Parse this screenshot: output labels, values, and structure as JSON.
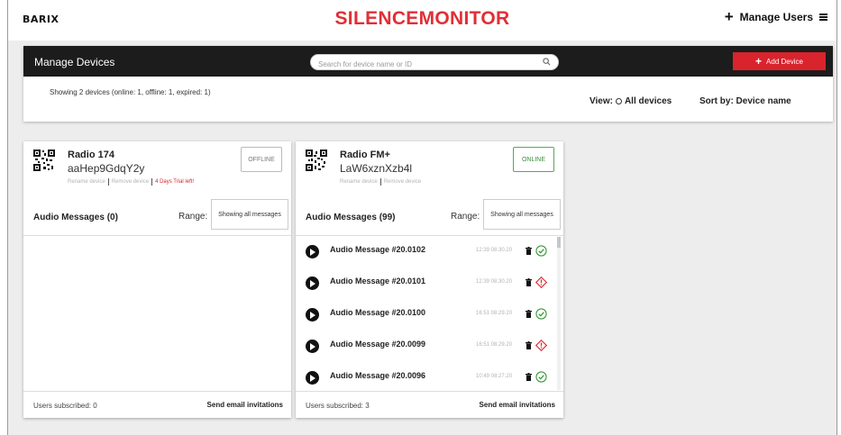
{
  "header": {
    "logo": "BARIX",
    "brand": "SILENCEMONITOR",
    "manage_users": "Manage Users"
  },
  "panel": {
    "title": "Manage Devices",
    "search_placeholder": "Search for device name or ID",
    "add_device": "Add Device",
    "summary": "Showing 2 devices (online: 1, offline: 1, expired: 1)",
    "view_label": "View:",
    "view_value": "All devices",
    "sort": "Sort by: Device name"
  },
  "devices": [
    {
      "name": "Radio 174",
      "id": "aaHep9GdqY2y",
      "rename": "Rename device",
      "remove": "Remove device",
      "trial": "4 Days Trial left!",
      "status": "OFFLINE",
      "messages_title": "Audio Messages (0)",
      "range_label": "Range:",
      "range_value": "Showing all messages",
      "users_subscribed": "Users subscribed: 0",
      "send_invitations": "Send email invitations",
      "messages": []
    },
    {
      "name": "Radio FM+",
      "id": "LaW6xznXzb4l",
      "rename": "Rename device",
      "remove": "Remove device",
      "status": "ONLINE",
      "messages_title": "Audio Messages (99)",
      "range_label": "Range:",
      "range_value": "Showing all messages",
      "users_subscribed": "Users subscribed: 3",
      "send_invitations": "Send email invitations",
      "messages": [
        {
          "name": "Audio Message #20.0102",
          "time": "12:39 08.30.20",
          "status": "check-icon"
        },
        {
          "name": "Audio Message #20.0101",
          "time": "12:39 08.30.20",
          "status": "warning-icon"
        },
        {
          "name": "Audio Message #20.0100",
          "time": "16:51 08.29.20",
          "status": "check-icon"
        },
        {
          "name": "Audio Message #20.0099",
          "time": "16:51 08.29.20",
          "status": "warning-icon"
        },
        {
          "name": "Audio Message #20.0096",
          "time": "10:49 08.27.20",
          "status": "check-icon"
        }
      ]
    }
  ],
  "colors": {
    "brand_red": "#e02f36",
    "button_red": "#d9232d",
    "online_green": "#3b8d3b",
    "header_dark": "#1c1c1c"
  }
}
